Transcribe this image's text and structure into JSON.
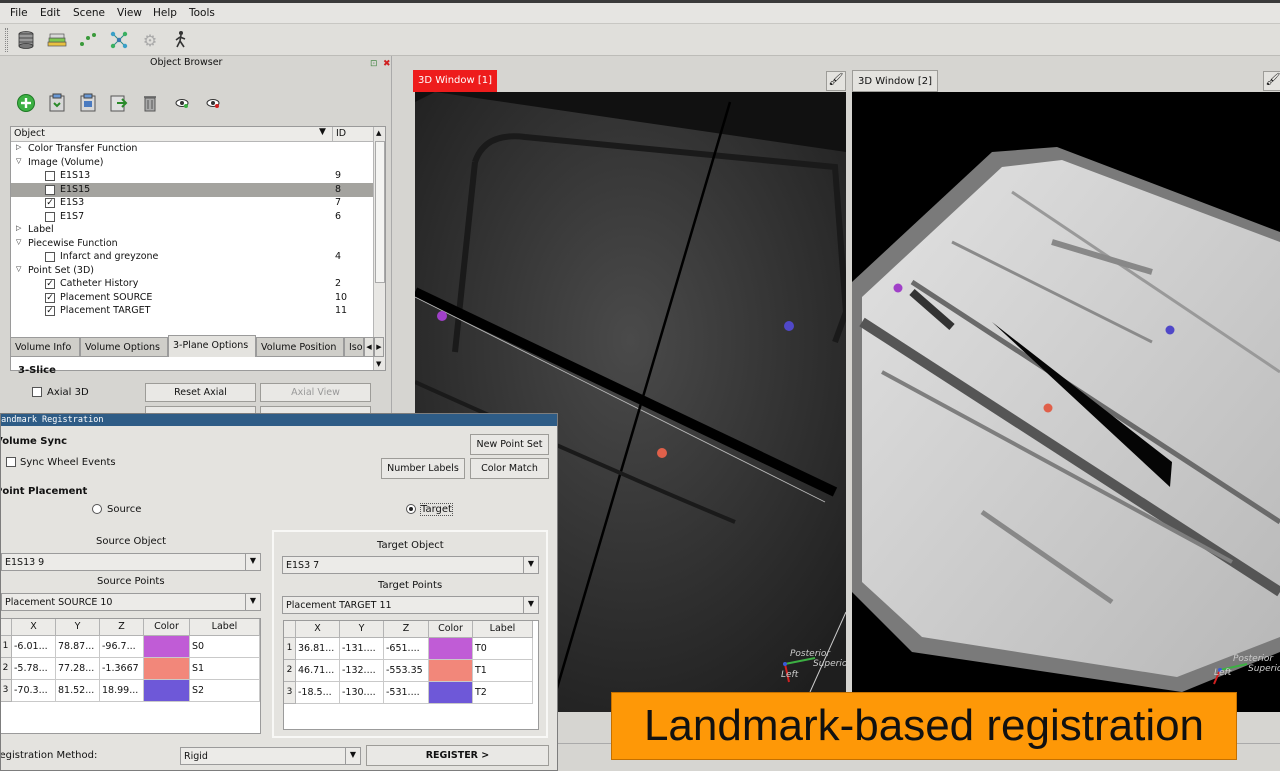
{
  "menu": [
    "File",
    "Edit",
    "Scene",
    "View",
    "Help",
    "Tools"
  ],
  "toolbar_icons": [
    "database-icon",
    "layers-icon",
    "points-icon",
    "network-icon",
    "gear-icon",
    "walk-icon"
  ],
  "object_browser": {
    "title": "Object Browser",
    "columns": {
      "object": "Object",
      "id": "ID"
    },
    "tree": [
      {
        "label": "Color Transfer Function",
        "id": "",
        "level": 0,
        "twisty": "collapsed",
        "checkbox": null,
        "selected": false
      },
      {
        "label": "Image (Volume)",
        "id": "",
        "level": 0,
        "twisty": "expanded",
        "checkbox": null,
        "selected": false
      },
      {
        "label": "E1S13",
        "id": "9",
        "level": 1,
        "twisty": null,
        "checkbox": false,
        "selected": false
      },
      {
        "label": "E1S15",
        "id": "8",
        "level": 1,
        "twisty": null,
        "checkbox": false,
        "selected": true
      },
      {
        "label": "E1S3",
        "id": "7",
        "level": 1,
        "twisty": null,
        "checkbox": true,
        "selected": false
      },
      {
        "label": "E1S7",
        "id": "6",
        "level": 1,
        "twisty": null,
        "checkbox": false,
        "selected": false
      },
      {
        "label": "Label",
        "id": "",
        "level": 0,
        "twisty": "collapsed",
        "checkbox": null,
        "selected": false
      },
      {
        "label": "Piecewise Function",
        "id": "",
        "level": 0,
        "twisty": "expanded",
        "checkbox": null,
        "selected": false
      },
      {
        "label": "Infarct and greyzone",
        "id": "4",
        "level": 1,
        "twisty": null,
        "checkbox": false,
        "selected": false
      },
      {
        "label": "Point Set (3D)",
        "id": "",
        "level": 0,
        "twisty": "expanded",
        "checkbox": null,
        "selected": false
      },
      {
        "label": "Catheter History",
        "id": "2",
        "level": 1,
        "twisty": null,
        "checkbox": true,
        "selected": false
      },
      {
        "label": "Placement SOURCE",
        "id": "10",
        "level": 1,
        "twisty": null,
        "checkbox": true,
        "selected": false
      },
      {
        "label": "Placement TARGET",
        "id": "11",
        "level": 1,
        "twisty": null,
        "checkbox": true,
        "selected": false
      }
    ],
    "tabs": [
      "Volume Info",
      "Volume Options",
      "3-Plane Options",
      "Volume Position",
      "Iso"
    ],
    "active_tab": "3-Plane Options",
    "section": "3-Slice",
    "axial_label": "Axial 3D",
    "reset_axial": "Reset Axial",
    "axial_view": "Axial View"
  },
  "viewports": {
    "left_tab": "3D Window [1]",
    "right_tab": "3D Window [2]",
    "orientation": {
      "posterior": "Posterior",
      "superior": "Superior",
      "left": "Left"
    }
  },
  "registration": {
    "title": "Landmark Registration",
    "volume_sync": "Volume Sync",
    "sync_wheel": "Sync Wheel Events",
    "new_point_set": "New Point Set",
    "number_labels": "Number Labels",
    "color_match": "Color Match",
    "point_placement": "Point Placement",
    "source_radio": "Source",
    "target_radio": "Target",
    "selected_mode": "Target",
    "source_object_label": "Source Object",
    "source_object_value": "E1S13 9",
    "source_points_label": "Source Points",
    "source_points_value": "Placement SOURCE 10",
    "target_object_label": "Target Object",
    "target_object_value": "E1S3 7",
    "target_points_label": "Target Points",
    "target_points_value": "Placement TARGET 11",
    "table_headers": [
      "X",
      "Y",
      "Z",
      "Color",
      "Label"
    ],
    "source_table": [
      {
        "n": "1",
        "x": "-6.01...",
        "y": "78.87...",
        "z": "-96.7...",
        "color": "#c05cd6",
        "label": "S0"
      },
      {
        "n": "2",
        "x": "-5.78...",
        "y": "77.28...",
        "z": "-1.3667",
        "color": "#f2877a",
        "label": "S1"
      },
      {
        "n": "3",
        "x": "-70.3...",
        "y": "81.52...",
        "z": "18.99...",
        "color": "#6e58d8",
        "label": "S2"
      }
    ],
    "target_table": [
      {
        "n": "1",
        "x": "36.81...",
        "y": "-131....",
        "z": "-651....",
        "color": "#c05cd6",
        "label": "T0"
      },
      {
        "n": "2",
        "x": "46.71...",
        "y": "-132....",
        "z": "-553.35",
        "color": "#f2877a",
        "label": "T1"
      },
      {
        "n": "3",
        "x": "-18.5...",
        "y": "-130....",
        "z": "-531....",
        "color": "#6e58d8",
        "label": "T2"
      }
    ],
    "method_label": "Registration Method:",
    "method_value": "Rigid",
    "register_button": "REGISTER >"
  },
  "caption": "Landmark-based registration"
}
